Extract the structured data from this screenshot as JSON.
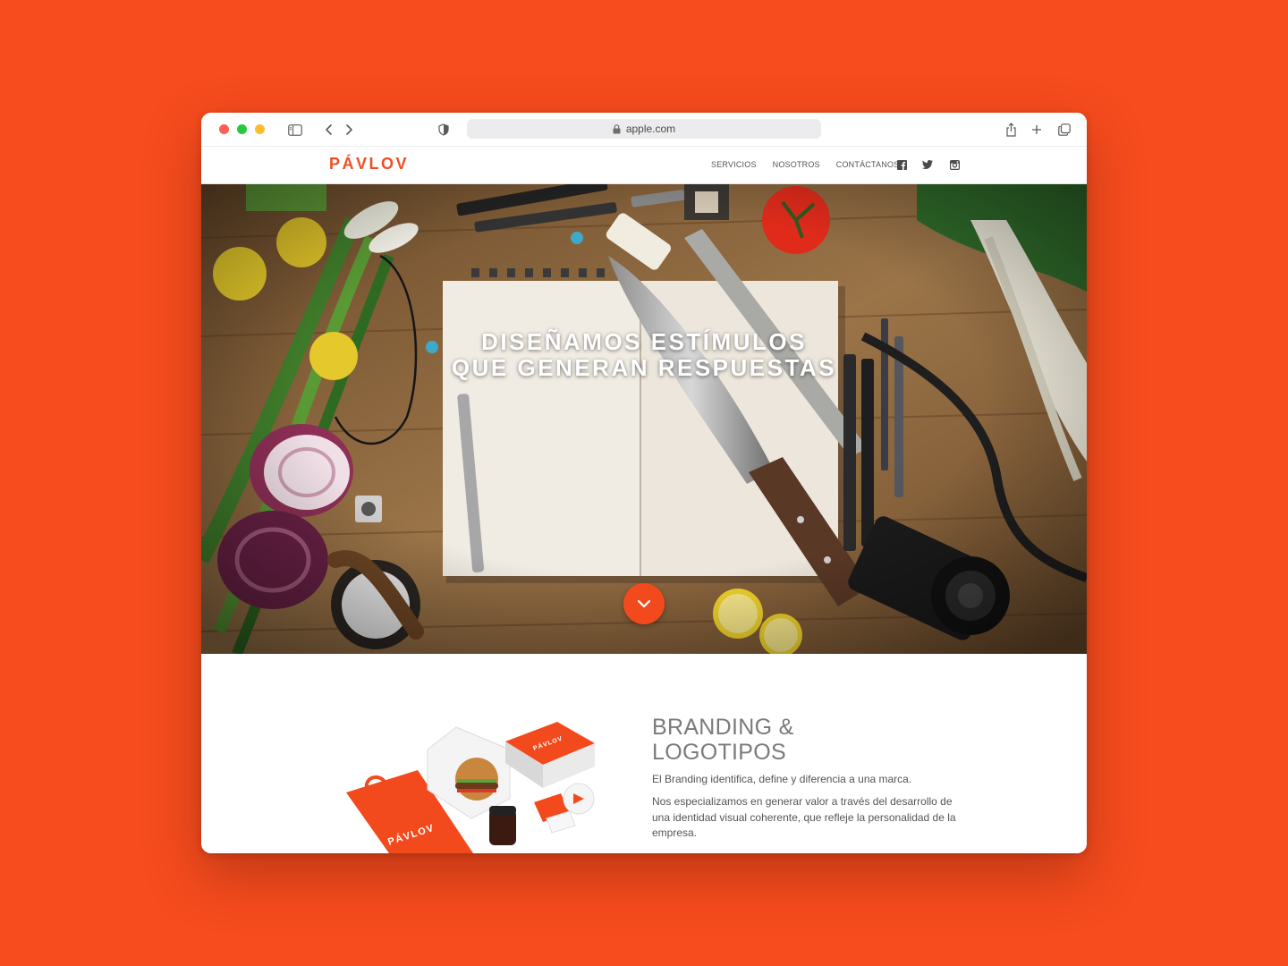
{
  "browser": {
    "url": "apple.com",
    "icons": [
      "sidebar-icon",
      "back-icon",
      "forward-icon",
      "privacy-shield-icon",
      "lock-icon",
      "share-icon",
      "new-tab-icon",
      "tabs-overview-icon"
    ]
  },
  "site": {
    "logo": "PÁVLOV",
    "brand_color": "#F04E23",
    "nav": [
      {
        "label": "SERVICIOS"
      },
      {
        "label": "NOSOTROS"
      },
      {
        "label": "CONTÁCTANOS"
      }
    ],
    "social_icons": [
      "facebook-icon",
      "twitter-icon",
      "instagram-icon"
    ]
  },
  "hero": {
    "title_line1": "DISEÑAMOS ESTÍMULOS",
    "title_line2": "QUE GENERAN RESPUESTAS",
    "scroll_icon": "chevron-down-icon"
  },
  "branding": {
    "title_line1": "BRANDING &",
    "title_line2": "LOGOTIPOS",
    "lead": "El Branding identifica, define y diferencia a una marca.",
    "body": "Nos especializamos en generar valor a través del desarrollo de una identidad visual coherente, que refleje la personalidad de la empresa.",
    "bag_text": "PÁVLOV",
    "box_text": "PÁVLOV"
  }
}
